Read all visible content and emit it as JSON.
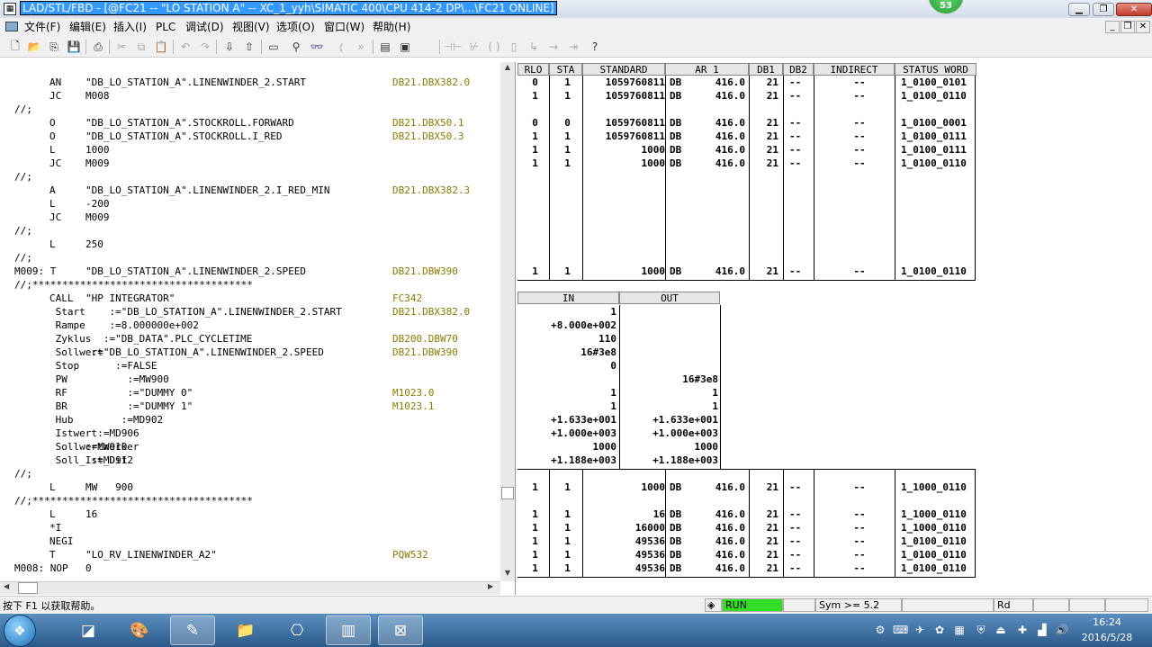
{
  "window": {
    "title_prefix": "LAD/STL/FBD  - [@FC21 -- \"LO STATION A\" -- XC_1_yyh\\SIMATIC 400\\CPU 414-2 DP\\...\\FC21  ONLINE]",
    "notification_count": "53",
    "min": "▁",
    "restore": "❐",
    "close": "✕"
  },
  "menu": [
    "文件(F)",
    "编辑(E)",
    "插入(I)",
    "PLC",
    "调试(D)",
    "视图(V)",
    "选项(O)",
    "窗口(W)",
    "帮助(H)"
  ],
  "mdi_buttons": [
    "_",
    "❐",
    "✕"
  ],
  "toolbar": [
    "new-icon",
    "open-icon",
    "accessible-nodes-icon",
    "save-icon",
    "print-icon",
    "cut-icon",
    "copy-icon",
    "paste-icon",
    "undo-icon",
    "redo-icon",
    "download-icon",
    "upload-icon",
    "monitor-icon",
    "overview-icon",
    "glasses-icon",
    "breakpoint-icon",
    "next-icon",
    "panel-icon",
    "panel2-icon",
    "contact-no-icon",
    "contact-nc-icon",
    "coil-icon",
    "box-icon",
    "branch-open-icon",
    "branch-close-icon",
    "connect-icon",
    "help-icon"
  ],
  "code_lines": [
    {
      "label": "",
      "op": "AN",
      "operand": "\"DB_LO_STATION_A\".LINENWINDER_2.START",
      "addr": "DB21.DBX382.0"
    },
    {
      "label": "",
      "op": "JC",
      "operand": "M008",
      "addr": ""
    },
    {
      "label": "//;",
      "op": "",
      "operand": "",
      "addr": ""
    },
    {
      "label": "",
      "op": "O",
      "operand": "\"DB_LO_STATION_A\".STOCKROLL.FORWARD",
      "addr": "DB21.DBX50.1"
    },
    {
      "label": "",
      "op": "O",
      "operand": "\"DB_LO_STATION_A\".STOCKROLL.I_RED",
      "addr": "DB21.DBX50.3"
    },
    {
      "label": "",
      "op": "L",
      "operand": "1000",
      "addr": ""
    },
    {
      "label": "",
      "op": "JC",
      "operand": "M009",
      "addr": ""
    },
    {
      "label": "//;",
      "op": "",
      "operand": "",
      "addr": ""
    },
    {
      "label": "",
      "op": "A",
      "operand": "\"DB_LO_STATION_A\".LINENWINDER_2.I_RED_MIN",
      "addr": "DB21.DBX382.3"
    },
    {
      "label": "",
      "op": "L",
      "operand": "-200",
      "addr": ""
    },
    {
      "label": "",
      "op": "JC",
      "operand": "M009",
      "addr": ""
    },
    {
      "label": "//;",
      "op": "",
      "operand": "",
      "addr": ""
    },
    {
      "label": "",
      "op": "L",
      "operand": "250",
      "addr": ""
    },
    {
      "label": "//;",
      "op": "",
      "operand": "",
      "addr": ""
    },
    {
      "label": "M009: T",
      "op": "",
      "operand": "\"DB_LO_STATION_A\".LINENWINDER_2.SPEED",
      "addr": "DB21.DBW390"
    },
    {
      "label": "//;*************************************",
      "op": "",
      "operand": "",
      "addr": ""
    },
    {
      "label": "",
      "op": "CALL",
      "operand": "\"HP INTEGRATOR\"",
      "addr": "FC342"
    },
    {
      "label": "",
      "op": " Start",
      "operand": "    :=\"DB_LO_STATION_A\".LINENWINDER_2.START",
      "addr": "DB21.DBX382.0"
    },
    {
      "label": "",
      "op": " Rampe",
      "operand": "    :=8.000000e+002",
      "addr": ""
    },
    {
      "label": "",
      "op": " Zyklus",
      "operand": "   :=\"DB_DATA\".PLC_CYCLETIME",
      "addr": "DB200.DBW70"
    },
    {
      "label": "",
      "op": " Sollwert",
      "operand": " :=\"DB_LO_STATION_A\".LINENWINDER_2.SPEED",
      "addr": "DB21.DBW390"
    },
    {
      "label": "",
      "op": " Stop",
      "operand": "     :=FALSE",
      "addr": ""
    },
    {
      "label": "",
      "op": " PW",
      "operand": "       :=MW900",
      "addr": ""
    },
    {
      "label": "",
      "op": " RF",
      "operand": "       :=\"DUMMY 0\"",
      "addr": "M1023.0"
    },
    {
      "label": "",
      "op": " BR",
      "operand": "       :=\"DUMMY 1\"",
      "addr": "M1023.1"
    },
    {
      "label": "",
      "op": " Hub",
      "operand": "      :=MD902",
      "addr": ""
    },
    {
      "label": "",
      "op": " Istwert",
      "operand": "  :=MD906",
      "addr": ""
    },
    {
      "label": "",
      "op": " Sollwertmerker",
      "operand": ":=MW910",
      "addr": ""
    },
    {
      "label": "",
      "op": " Soll_Ist_Dif",
      "operand": " :=MD912",
      "addr": ""
    },
    {
      "label": "//;",
      "op": "",
      "operand": "",
      "addr": ""
    },
    {
      "label": "",
      "op": "L",
      "operand": "MW   900",
      "addr": ""
    },
    {
      "label": "//;*************************************",
      "op": "",
      "operand": "",
      "addr": ""
    },
    {
      "label": "",
      "op": "L",
      "operand": "16",
      "addr": ""
    },
    {
      "label": "",
      "op": "*I",
      "operand": "",
      "addr": ""
    },
    {
      "label": "",
      "op": "NEGI",
      "operand": "",
      "addr": ""
    },
    {
      "label": "",
      "op": "T",
      "operand": "\"LO_RV_LINENWINDER_A2\"",
      "addr": "PQW532"
    },
    {
      "label": "M008: NOP",
      "op": "",
      "operand": "0",
      "addr": ""
    }
  ],
  "status_headers": [
    "RLO",
    "STA",
    "STANDARD",
    "AR 1",
    "DB1",
    "DB2",
    "INDIRECT",
    "STATUS WORD"
  ],
  "status_top": [
    {
      "row": 0,
      "rlo": "0",
      "sta": "1",
      "std": "1059760811",
      "ar": "DB",
      "arv": "416.0",
      "db1": "21",
      "db2": "--",
      "ind": "--",
      "sw": "1_0100_0101"
    },
    {
      "row": 1,
      "rlo": "1",
      "sta": "1",
      "std": "1059760811",
      "ar": "DB",
      "arv": "416.0",
      "db1": "21",
      "db2": "--",
      "ind": "--",
      "sw": "1_0100_0110"
    },
    {
      "row": 3,
      "rlo": "0",
      "sta": "0",
      "std": "1059760811",
      "ar": "DB",
      "arv": "416.0",
      "db1": "21",
      "db2": "--",
      "ind": "--",
      "sw": "1_0100_0001"
    },
    {
      "row": 4,
      "rlo": "1",
      "sta": "1",
      "std": "1059760811",
      "ar": "DB",
      "arv": "416.0",
      "db1": "21",
      "db2": "--",
      "ind": "--",
      "sw": "1_0100_0111"
    },
    {
      "row": 5,
      "rlo": "1",
      "sta": "1",
      "std": "1000",
      "ar": "DB",
      "arv": "416.0",
      "db1": "21",
      "db2": "--",
      "ind": "--",
      "sw": "1_0100_0111"
    },
    {
      "row": 6,
      "rlo": "1",
      "sta": "1",
      "std": "1000",
      "ar": "DB",
      "arv": "416.0",
      "db1": "21",
      "db2": "--",
      "ind": "--",
      "sw": "1_0100_0110"
    },
    {
      "row": 14,
      "rlo": "1",
      "sta": "1",
      "std": "1000",
      "ar": "DB",
      "arv": "416.0",
      "db1": "21",
      "db2": "--",
      "ind": "--",
      "sw": "1_0100_0110"
    }
  ],
  "io_headers": [
    "IN",
    "OUT"
  ],
  "io_rows": [
    {
      "row": 17,
      "in": "1",
      "out": ""
    },
    {
      "row": 18,
      "in": "+8.000e+002",
      "out": ""
    },
    {
      "row": 19,
      "in": "110",
      "out": ""
    },
    {
      "row": 20,
      "in": "16#3e8",
      "out": ""
    },
    {
      "row": 21,
      "in": "0",
      "out": ""
    },
    {
      "row": 22,
      "in": "",
      "out": "16#3e8"
    },
    {
      "row": 23,
      "in": "1",
      "out": "1"
    },
    {
      "row": 24,
      "in": "1",
      "out": "1"
    },
    {
      "row": 25,
      "in": "+1.633e+001",
      "out": "+1.633e+001"
    },
    {
      "row": 26,
      "in": "+1.000e+003",
      "out": "+1.000e+003"
    },
    {
      "row": 27,
      "in": "1000",
      "out": "1000"
    },
    {
      "row": 28,
      "in": "+1.188e+003",
      "out": "+1.188e+003"
    }
  ],
  "status_bottom": [
    {
      "row": 30,
      "rlo": "1",
      "sta": "1",
      "std": "1000",
      "ar": "DB",
      "arv": "416.0",
      "db1": "21",
      "db2": "--",
      "ind": "--",
      "sw": "1_1000_0110"
    },
    {
      "row": 32,
      "rlo": "1",
      "sta": "1",
      "std": "16",
      "ar": "DB",
      "arv": "416.0",
      "db1": "21",
      "db2": "--",
      "ind": "--",
      "sw": "1_1000_0110"
    },
    {
      "row": 33,
      "rlo": "1",
      "sta": "1",
      "std": "16000",
      "ar": "DB",
      "arv": "416.0",
      "db1": "21",
      "db2": "--",
      "ind": "--",
      "sw": "1_1000_0110"
    },
    {
      "row": 34,
      "rlo": "1",
      "sta": "1",
      "std": "49536",
      "ar": "DB",
      "arv": "416.0",
      "db1": "21",
      "db2": "--",
      "ind": "--",
      "sw": "1_0100_0110"
    },
    {
      "row": 35,
      "rlo": "1",
      "sta": "1",
      "std": "49536",
      "ar": "DB",
      "arv": "416.0",
      "db1": "21",
      "db2": "--",
      "ind": "--",
      "sw": "1_0100_0110"
    },
    {
      "row": 36,
      "rlo": "1",
      "sta": "1",
      "std": "49536",
      "ar": "DB",
      "arv": "416.0",
      "db1": "21",
      "db2": "--",
      "ind": "--",
      "sw": "1_0100_0110"
    }
  ],
  "statusbar": {
    "help": "按下 F1 以获取帮助。",
    "mode": "RUN",
    "sym": "Sym >= 5.2",
    "access": "Rd"
  },
  "taskbar": {
    "time": "16:24",
    "date": "2016/5/28"
  }
}
